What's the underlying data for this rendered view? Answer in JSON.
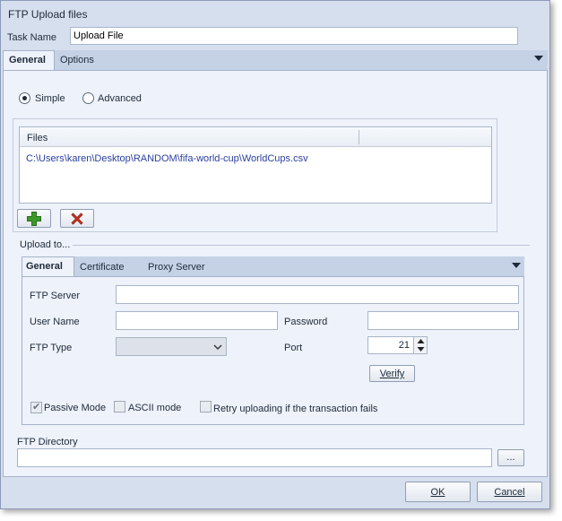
{
  "window": {
    "title": "FTP Upload files"
  },
  "task": {
    "label": "Task Name",
    "value": "Upload File"
  },
  "main_tabs": [
    {
      "label": "General",
      "active": true
    },
    {
      "label": "Options",
      "active": false
    }
  ],
  "mode": {
    "simple_label": "Simple",
    "advanced_label": "Advanced",
    "selected": "Simple"
  },
  "files": {
    "column_header": "Files",
    "rows": [
      "C:\\Users\\karen\\Desktop\\RANDOM\\fifa-world-cup\\WorldCups.csv"
    ]
  },
  "upload": {
    "group_label": "Upload to...",
    "tabs": [
      {
        "label": "General",
        "active": true
      },
      {
        "label": "Certificate",
        "active": false
      },
      {
        "label": "Proxy Server",
        "active": false
      }
    ],
    "ftp_server_label": "FTP Server",
    "ftp_server_value": "",
    "user_name_label": "User Name",
    "user_name_value": "",
    "password_label": "Password",
    "password_value": "",
    "ftp_type_label": "FTP Type",
    "ftp_type_value": "",
    "port_label": "Port",
    "port_value": "21",
    "verify_label": "Verify",
    "passive_mode_label": "Passive Mode",
    "passive_mode_checked": true,
    "ascii_mode_label": "ASCII mode",
    "ascii_mode_checked": false,
    "retry_label": "Retry uploading if the transaction fails",
    "retry_checked": false
  },
  "directory": {
    "label": "FTP Directory",
    "value": "",
    "browse_label": "..."
  },
  "footer": {
    "ok_label": "OK",
    "cancel_label": "Cancel"
  },
  "colors": {
    "window_bg": "#d6dfee",
    "panel_bg": "#eef2fa",
    "tabstrip_bg": "#c5d2e6",
    "file_link": "#2a3fa0",
    "add_icon": "#3c9a2a",
    "remove_icon": "#d0321e"
  }
}
